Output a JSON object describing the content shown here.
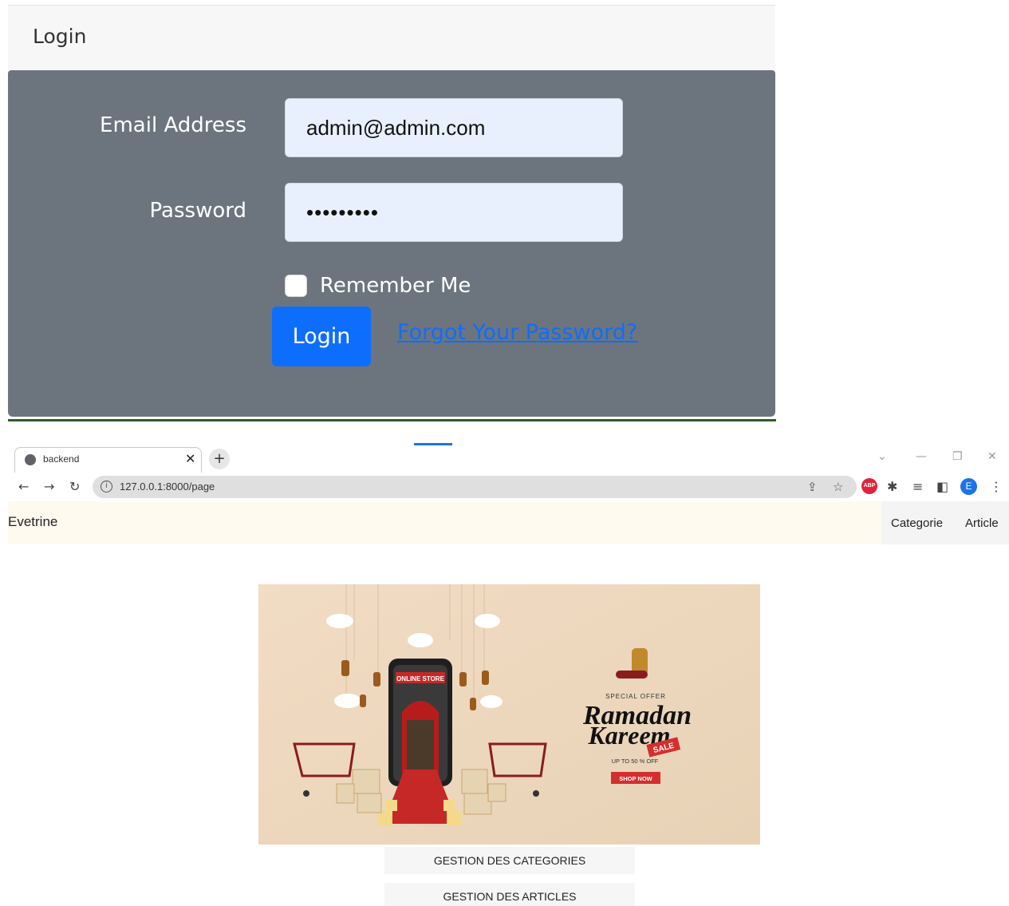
{
  "login": {
    "header_title": "Login",
    "email_label": "Email Address",
    "email_value": "admin@admin.com",
    "password_label": "Password",
    "password_value": "•••••••••",
    "remember_label": "Remember Me",
    "remember_checked": false,
    "submit_label": "Login",
    "forgot_label": "Forgot Your Password?",
    "colors": {
      "card_body": "#6c757d",
      "primary": "#0d6efd",
      "input_bg": "#e8f0fe"
    }
  },
  "browser": {
    "tab_title": "backend",
    "tab_icon": "globe-icon",
    "close_glyph": "✕",
    "newtab_glyph": "+",
    "url": "127.0.0.1:8000/page",
    "profile_initial": "E",
    "abp_label": "ABP",
    "info_glyph": "i"
  },
  "site": {
    "brand": "Evetrine",
    "nav": [
      "Categorie",
      "Article"
    ],
    "banner": {
      "store_sign": "ONLINE STORE",
      "special_offer": "SPECIAL OFFER",
      "headline_line1": "Ramadan",
      "headline_line2": "Kareem",
      "sale_tag": "SALE",
      "discount": "UP TO 50 % OFF",
      "cta": "SHOP NOW"
    },
    "menu": [
      "GESTION DES CATEGORIES",
      "GESTION DES ARTICLES"
    ]
  }
}
